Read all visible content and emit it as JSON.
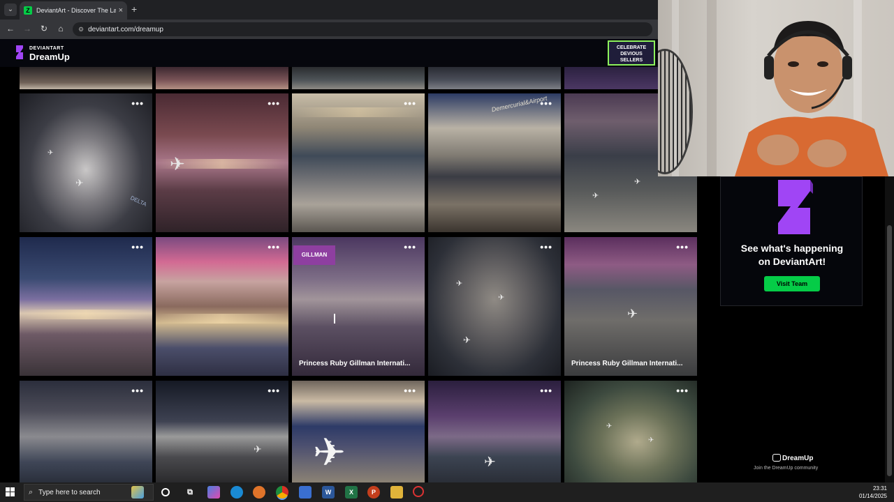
{
  "browser": {
    "tab_title": "DeviantArt - Discover The Larg",
    "tab_favicon": "deviantart-icon",
    "close_glyph": "×",
    "new_tab_glyph": "+",
    "url": "deviantart.com/dreamup"
  },
  "header": {
    "brand_small": "DEVIANTART",
    "brand_name": "DreamUp",
    "promo_line1": "CELEBRATE",
    "promo_line2": "DEVIOUS",
    "promo_line3": "SELLERS"
  },
  "gallery": {
    "caption_1": "Princess Ruby Gillman Internati...",
    "caption_2": "Princess Ruby Gillman Internati...",
    "banner_word_1": "Demercurial&Airport",
    "banner_word_2": "GILLMAN",
    "tail_text": "DELTA",
    "more_glyph": "•••"
  },
  "promo_card": {
    "headline_line1": "See what's happening",
    "headline_line2": "on DeviantArt!",
    "button_label": "Visit Team"
  },
  "community": {
    "logo_text": "DreamUp",
    "subtitle": "Join the DreamUp community"
  },
  "taskbar": {
    "search_placeholder": "Type here to search",
    "time": "23:31",
    "date": "01/14/2025"
  },
  "colors": {
    "brand_green": "#05cc47",
    "brand_purple": "#a045f5",
    "promo_border": "#8df25c"
  }
}
